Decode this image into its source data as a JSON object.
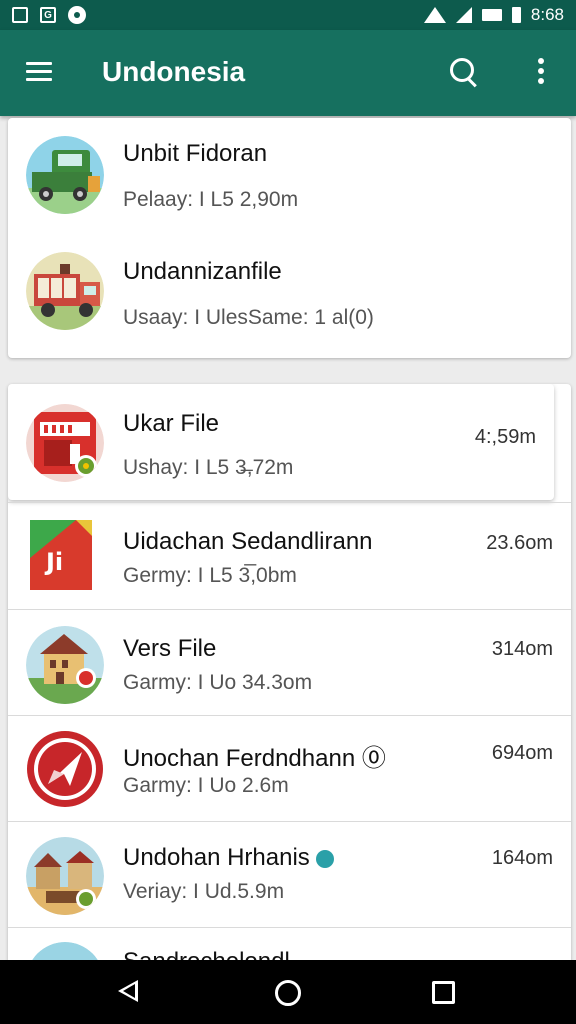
{
  "status_bar": {
    "left_icon_2": "G",
    "time": "8:68"
  },
  "app_bar": {
    "title": "Undonesia",
    "icons": [
      "menu-icon",
      "search-icon",
      "more-vert-icon"
    ]
  },
  "card_top": {
    "items": [
      {
        "title": "Unbit Fidoran",
        "subtitle": "Pelaay: I L5 2,90m"
      },
      {
        "title": "Undannizanfile",
        "subtitle": "Usaay: I UlesSame: 1 al(0)"
      }
    ]
  },
  "file_list": {
    "items": [
      {
        "title": "Ukar File",
        "subtitle": "Ushay: I L5 3̶,72m",
        "size": "4:,59m",
        "selected": true
      },
      {
        "title": "Uidachan Sedandlirann",
        "subtitle": "Germy: I L5 3̅,0bm",
        "size": "23.6om"
      },
      {
        "title": "Vers File",
        "subtitle": "Garmy: I Uo 34.3om",
        "size": "314om"
      },
      {
        "title": "Unochan Ferdndhann ⓪",
        "subtitle": "Garmy: I Uo 2.6m",
        "size": "694om"
      },
      {
        "title": "Undohan Hrhanis",
        "subtitle": "Veriay: I Ud.5.9m",
        "size": "164om"
      },
      {
        "title": "Sandrochelondl",
        "subtitle": "",
        "size": ""
      }
    ]
  },
  "colors": {
    "status_bar": "#0d5b4d",
    "app_bar": "#16705f",
    "background": "#ececec"
  }
}
